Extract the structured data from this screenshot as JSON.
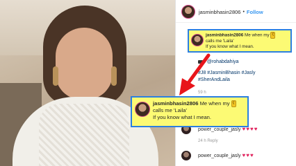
{
  "post": {
    "username": "jasminbhasin2806",
    "dot": "•",
    "follow": "Follow"
  },
  "caption": {
    "username": "jasminbhasin2806",
    "line1": "Me when my",
    "line2": "calls me 'Laila'",
    "line3": "If you know what I mean.",
    "emoji_icon": "bear-emoji"
  },
  "credit": {
    "camera_icon": "camera-emoji",
    "text": ": @rohabdahiya"
  },
  "hashtags": {
    "line1": "#J8 #JasminBhasin #Jasly",
    "line2": "#SherAndLaila"
  },
  "time": "59 h",
  "comments": [
    {
      "username": "power_couple_jasly",
      "hearts": "♥♥♥♥",
      "meta": "24 h  Reply"
    },
    {
      "username": "power_couple_jasly",
      "hearts": "♥♥♥"
    }
  ],
  "colors": {
    "highlight": "#fcfa74",
    "border": "#2b7fe0",
    "arrow": "#e8151b",
    "link": "#3897f0"
  }
}
